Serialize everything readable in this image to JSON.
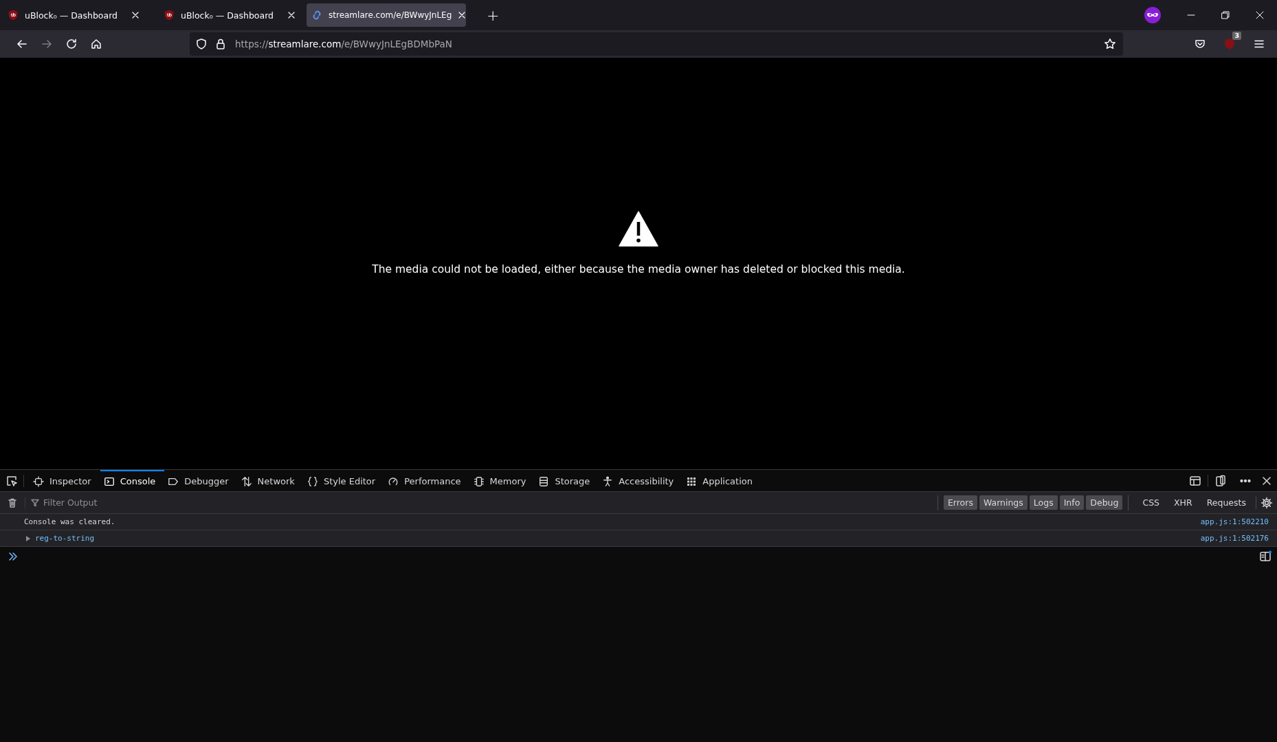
{
  "tabs": [
    {
      "title": "uBlock₀ — Dashboard",
      "selected": false
    },
    {
      "title": "uBlock₀ — Dashboard",
      "selected": false
    },
    {
      "title": "streamlare.com/e/BWwyJnLEg",
      "selected": true
    }
  ],
  "new_tab": "+",
  "address_bar": {
    "scheme": "https://",
    "host": "streamlare.com",
    "path": "/e/BWwyJnLEgBDMbPaN"
  },
  "extension_badge": "3",
  "page": {
    "message": "The media could not be loaded, either because the media owner has deleted or blocked this media."
  },
  "devtools": {
    "tabs": [
      {
        "label": "Inspector",
        "selected": false
      },
      {
        "label": "Console",
        "selected": true
      },
      {
        "label": "Debugger",
        "selected": false
      },
      {
        "label": "Network",
        "selected": false
      },
      {
        "label": "Style Editor",
        "selected": false
      },
      {
        "label": "Performance",
        "selected": false
      },
      {
        "label": "Memory",
        "selected": false
      },
      {
        "label": "Storage",
        "selected": false
      },
      {
        "label": "Accessibility",
        "selected": false
      },
      {
        "label": "Application",
        "selected": false
      }
    ],
    "filter": {
      "placeholder": "Filter Output"
    },
    "levels": [
      {
        "label": "Errors",
        "selected": true
      },
      {
        "label": "Warnings",
        "selected": true
      },
      {
        "label": "Logs",
        "selected": true
      },
      {
        "label": "Info",
        "selected": true
      },
      {
        "label": "Debug",
        "selected": true
      }
    ],
    "extras": [
      {
        "label": "CSS",
        "selected": false
      },
      {
        "label": "XHR",
        "selected": false
      },
      {
        "label": "Requests",
        "selected": false
      }
    ],
    "messages": [
      {
        "kind": "text",
        "text": "Console was cleared.",
        "source": "app.js:1:502210"
      },
      {
        "kind": "object",
        "text": "reg-to-string",
        "source": "app.js:1:502176"
      }
    ]
  }
}
